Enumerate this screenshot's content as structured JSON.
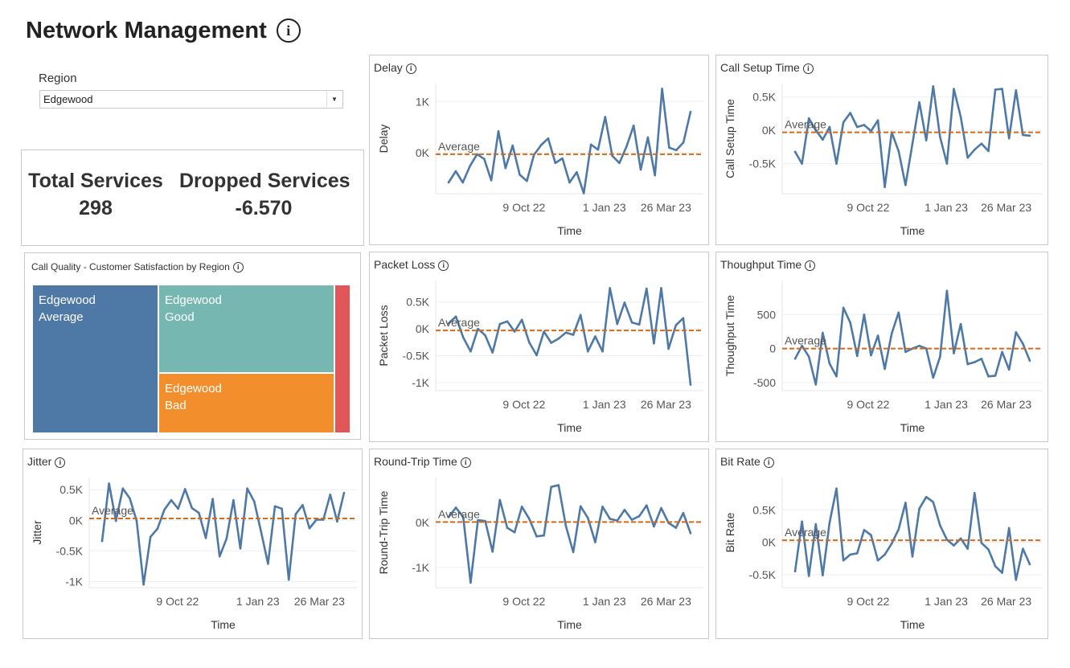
{
  "dashboard": {
    "title": "Network Management",
    "title_info_icon": "info-circle-icon"
  },
  "filter": {
    "label": "Region",
    "value": "Edgewood",
    "dropdown_icon": "chevron-down-icon"
  },
  "kpis": {
    "total_services": {
      "label": "Total Services",
      "value": "298"
    },
    "dropped_services": {
      "label": "Dropped Services",
      "value": "-6.570"
    }
  },
  "treemap": {
    "title": "Call Quality - Customer Satisfaction by Region",
    "cells": [
      {
        "region": "Edgewood",
        "category": "Average",
        "color": "#4e79a7"
      },
      {
        "region": "Edgewood",
        "category": "Good",
        "color": "#76b7b2"
      },
      {
        "region": "Edgewood",
        "category": "Bad",
        "color": "#f28e2b"
      },
      {
        "region": "",
        "category": "",
        "color": "#e15759"
      }
    ]
  },
  "colors": {
    "line": "#4e79a7",
    "average": "#d46a17",
    "axis_text": "#555555",
    "gridline": "#eeeeee"
  },
  "average_label": "Average",
  "x_axis_title": "Time",
  "chart_data": [
    {
      "id": "delay",
      "type": "line",
      "title": "Delay",
      "ylabel": "Delay",
      "xlabel": "Time",
      "x_ticks": [
        "9 Oct 22",
        "1 Jan 23",
        "26 Mar 23"
      ],
      "y_ticks": [
        {
          "label": "1K",
          "value": 1000
        },
        {
          "label": "0K",
          "value": 0
        }
      ],
      "ylim": [
        -800,
        1350
      ],
      "average": -30,
      "values": [
        -580,
        -360,
        -580,
        -260,
        -30,
        -120,
        -540,
        420,
        -300,
        140,
        -430,
        -550,
        -40,
        150,
        280,
        -200,
        -110,
        -580,
        -380,
        -790,
        160,
        60,
        700,
        -60,
        -200,
        120,
        530,
        -330,
        300,
        -440,
        1250,
        100,
        50,
        200,
        800
      ]
    },
    {
      "id": "call_setup_time",
      "type": "line",
      "title": "Call Setup Time",
      "ylabel": "Call Setup Time",
      "xlabel": "Time",
      "x_ticks": [
        "9 Oct 22",
        "1 Jan 23",
        "26 Mar 23"
      ],
      "y_ticks": [
        {
          "label": "0.5K",
          "value": 500
        },
        {
          "label": "0K",
          "value": 0
        },
        {
          "label": "-0.5K",
          "value": -500
        }
      ],
      "ylim": [
        -950,
        700
      ],
      "average": -30,
      "values": [
        -320,
        -500,
        180,
        0,
        -140,
        50,
        -500,
        120,
        260,
        50,
        80,
        -10,
        150,
        -850,
        -30,
        -310,
        -820,
        -200,
        420,
        -150,
        660,
        -100,
        -500,
        620,
        200,
        -410,
        -290,
        -200,
        -310,
        610,
        620,
        -120,
        600,
        -70,
        -80
      ]
    },
    {
      "id": "packet_loss",
      "type": "line",
      "title": "Packet Loss",
      "ylabel": "Packet Loss",
      "xlabel": "Time",
      "x_ticks": [
        "9 Oct 22",
        "1 Jan 23",
        "26 Mar 23"
      ],
      "y_ticks": [
        {
          "label": "0.5K",
          "value": 500
        },
        {
          "label": "0K",
          "value": 0
        },
        {
          "label": "-0.5K",
          "value": -500
        },
        {
          "label": "-1K",
          "value": -1000
        }
      ],
      "ylim": [
        -1150,
        900
      ],
      "average": -30,
      "values": [
        100,
        230,
        -160,
        -420,
        0,
        -120,
        -440,
        90,
        140,
        -50,
        170,
        -250,
        -490,
        -50,
        -260,
        -180,
        -70,
        -110,
        260,
        -420,
        -140,
        -420,
        760,
        90,
        490,
        120,
        80,
        750,
        -270,
        760,
        -370,
        70,
        200,
        -1040
      ]
    },
    {
      "id": "thoughput_time",
      "type": "line",
      "title": "Thoughput Time",
      "ylabel": "Thoughput Time",
      "xlabel": "Time",
      "x_ticks": [
        "9 Oct 22",
        "1 Jan 23",
        "26 Mar 23"
      ],
      "y_ticks": [
        {
          "label": "500",
          "value": 500
        },
        {
          "label": "0",
          "value": 0
        },
        {
          "label": "-500",
          "value": -500
        }
      ],
      "ylim": [
        -620,
        1000
      ],
      "average": 0,
      "values": [
        -150,
        40,
        -120,
        -530,
        230,
        -220,
        -410,
        600,
        380,
        -110,
        500,
        -100,
        190,
        -300,
        220,
        530,
        -50,
        0,
        40,
        0,
        -430,
        -120,
        850,
        -70,
        360,
        -230,
        -200,
        -150,
        -410,
        -400,
        -50,
        -310,
        240,
        70,
        -180
      ]
    },
    {
      "id": "jitter",
      "type": "line",
      "title": "Jitter",
      "ylabel": "Jitter",
      "xlabel": "Time",
      "x_ticks": [
        "9 Oct 22",
        "1 Jan 23",
        "26 Mar 23"
      ],
      "y_ticks": [
        {
          "label": "0.5K",
          "value": 500
        },
        {
          "label": "0K",
          "value": 0
        },
        {
          "label": "-0.5K",
          "value": -500
        },
        {
          "label": "-1K",
          "value": -1000
        }
      ],
      "ylim": [
        -1100,
        700
      ],
      "average": 30,
      "values": [
        -340,
        600,
        -10,
        520,
        360,
        -10,
        -1050,
        -270,
        -140,
        170,
        330,
        190,
        510,
        200,
        120,
        -290,
        350,
        -590,
        -300,
        330,
        -460,
        520,
        310,
        -190,
        -710,
        230,
        190,
        -970,
        100,
        250,
        -130,
        10,
        10,
        420,
        -20,
        450
      ]
    },
    {
      "id": "round_trip_time",
      "type": "line",
      "title": "Round-Trip Time",
      "ylabel": "Round-Trip Time",
      "xlabel": "Time",
      "x_ticks": [
        "9 Oct 22",
        "1 Jan 23",
        "26 Mar 23"
      ],
      "y_ticks": [
        {
          "label": "0K",
          "value": 0
        },
        {
          "label": "-1K",
          "value": -1000
        }
      ],
      "ylim": [
        -1450,
        1000
      ],
      "average": 10,
      "values": [
        120,
        330,
        120,
        -1340,
        50,
        30,
        -650,
        500,
        -120,
        -220,
        350,
        80,
        -310,
        -290,
        790,
        830,
        -80,
        -660,
        360,
        100,
        -440,
        350,
        80,
        40,
        280,
        60,
        140,
        380,
        -90,
        320,
        -10,
        -120,
        210,
        -240
      ]
    },
    {
      "id": "bit_rate",
      "type": "line",
      "title": "Bit Rate",
      "ylabel": "Bit Rate",
      "xlabel": "Time",
      "x_ticks": [
        "9 Oct 22",
        "1 Jan 23",
        "26 Mar 23"
      ],
      "y_ticks": [
        {
          "label": "0.5K",
          "value": 500
        },
        {
          "label": "0K",
          "value": 0
        },
        {
          "label": "-0.5K",
          "value": -500
        }
      ],
      "ylim": [
        -700,
        1000
      ],
      "average": 30,
      "values": [
        -450,
        320,
        -520,
        280,
        -510,
        300,
        830,
        -280,
        -190,
        -170,
        190,
        110,
        -280,
        -190,
        -20,
        200,
        610,
        -220,
        520,
        700,
        620,
        260,
        40,
        -50,
        60,
        -100,
        760,
        -10,
        -110,
        -370,
        -470,
        220,
        -580,
        -100,
        -340
      ]
    }
  ]
}
